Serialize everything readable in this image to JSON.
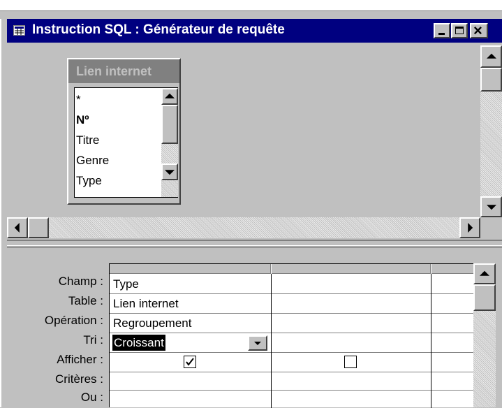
{
  "window": {
    "title": "Instruction SQL : Générateur de requête",
    "controls": [
      "_",
      "□",
      "×"
    ]
  },
  "table_box": {
    "title": "Lien internet",
    "fields": [
      {
        "name": "*",
        "bold": false
      },
      {
        "name": "Nº",
        "bold": true
      },
      {
        "name": "Titre",
        "bold": false
      },
      {
        "name": "Genre",
        "bold": false
      },
      {
        "name": "Type",
        "bold": false
      }
    ]
  },
  "grid": {
    "row_labels": [
      "Champ :",
      "Table :",
      "Opération :",
      "Tri :",
      "Afficher :",
      "Critères :",
      "Ou :"
    ],
    "columns": [
      {
        "champ": "Type",
        "table": "Lien internet",
        "operation": "Regroupement",
        "tri": "Croissant",
        "afficher": true
      },
      {
        "champ": "",
        "table": "",
        "operation": "",
        "tri": "",
        "afficher": false
      }
    ]
  },
  "icons": [
    "query-window-icon",
    "minimize-icon",
    "maximize-icon",
    "close-icon",
    "dropdown-arrow-icon",
    "checkbox-checked-icon",
    "checkbox-unchecked-icon"
  ]
}
